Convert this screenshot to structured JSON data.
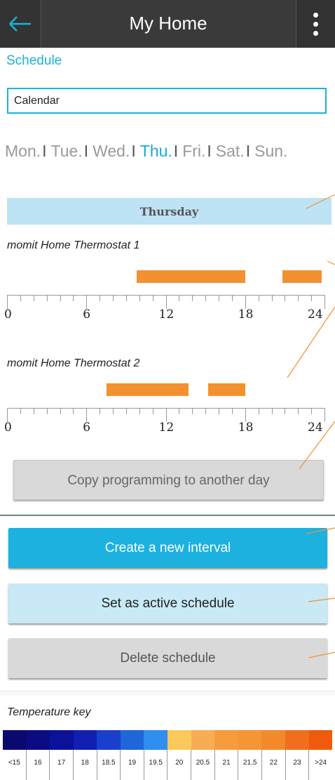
{
  "header": {
    "title": "My Home"
  },
  "schedule_link": "Schedule",
  "calendar": {
    "value": "Calendar"
  },
  "days": [
    {
      "label": "Mon.",
      "active": false
    },
    {
      "label": "Tue.",
      "active": false
    },
    {
      "label": "Wed.",
      "active": false
    },
    {
      "label": "Thu.",
      "active": true
    },
    {
      "label": "Fri.",
      "active": false
    },
    {
      "label": "Sat.",
      "active": false
    },
    {
      "label": "Sun.",
      "active": false
    }
  ],
  "day_header": "Thursday",
  "thermostats": [
    {
      "name": "momit Home Thermostat 1",
      "intervals": [
        [
          9.8,
          18.0
        ],
        [
          20.8,
          23.8
        ]
      ]
    },
    {
      "name": "momit Home Thermostat 2",
      "intervals": [
        [
          7.5,
          13.7
        ],
        [
          15.2,
          18.0
        ]
      ]
    }
  ],
  "axis_labels": [
    "0",
    "6",
    "12",
    "18",
    "24"
  ],
  "buttons": {
    "copy": "Copy programming to another day",
    "create": "Create a new interval",
    "set_active": "Set as active schedule",
    "delete": "Delete schedule"
  },
  "temperature_key": {
    "title": "Temperature key",
    "items": [
      {
        "label": "<15",
        "color": "#0a0a6e"
      },
      {
        "label": "16",
        "color": "#0b0b84"
      },
      {
        "label": "17",
        "color": "#0c119a"
      },
      {
        "label": "18",
        "color": "#1120b4"
      },
      {
        "label": "18.5",
        "color": "#1a3fcf"
      },
      {
        "label": "19",
        "color": "#1f66d8"
      },
      {
        "label": "19.5",
        "color": "#2f8ef0"
      },
      {
        "label": "20",
        "color": "#fcc85a"
      },
      {
        "label": "20.5",
        "color": "#f8ad52"
      },
      {
        "label": "21",
        "color": "#f69c3c"
      },
      {
        "label": "21.5",
        "color": "#f59534"
      },
      {
        "label": "22",
        "color": "#f28a2a"
      },
      {
        "label": "23",
        "color": "#ef6f1e"
      },
      {
        "label": ">24",
        "color": "#ef5a0c"
      }
    ]
  },
  "colors": {
    "accent": "#1ab3d8",
    "interval": "#f39030",
    "annotation": "#f39030"
  }
}
